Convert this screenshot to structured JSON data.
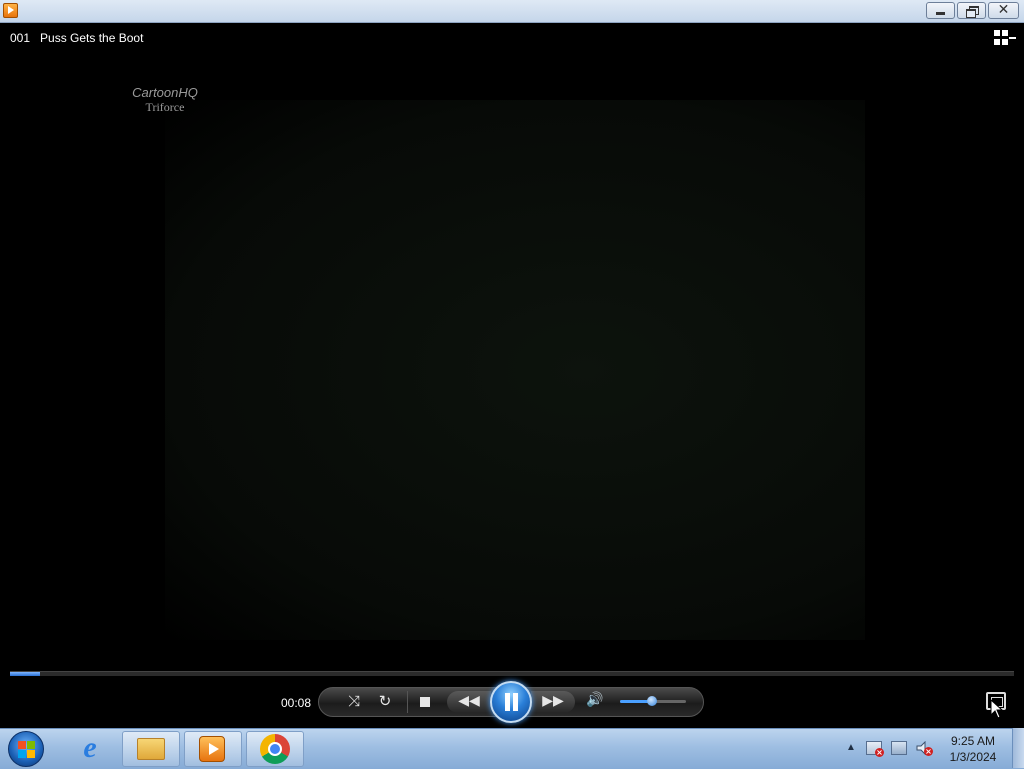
{
  "window": {
    "app_icon": "windows-media-player-icon",
    "controls": {
      "minimize": "minimize-icon",
      "maximize": "restore-icon",
      "close_label": "✕"
    }
  },
  "video": {
    "title": "001   Puss Gets the Boot",
    "watermark_line1": "CartoonHQ",
    "watermark_line2": "Triforce"
  },
  "player": {
    "elapsed": "00:08",
    "progress": 0.03,
    "volume": 0.5,
    "state": "playing",
    "icons": {
      "shuffle": "shuffle-icon",
      "repeat": "repeat-icon",
      "stop": "stop-icon",
      "previous": "previous-icon",
      "play_pause": "pause-icon",
      "next": "next-icon",
      "mute": "speaker-icon",
      "switch_library": "switch-to-library-icon",
      "fullscreen": "fullscreen-icon"
    },
    "glyphs": {
      "shuffle": "⤨",
      "repeat": "↻",
      "previous": "◀◀",
      "next": "▶▶",
      "mute": "🔊"
    },
    "accent": "#2a7fd8"
  },
  "taskbar": {
    "apps": [
      "Internet Explorer",
      "Windows Explorer",
      "Windows Media Player",
      "Google Chrome"
    ],
    "active_app": "Windows Media Player",
    "tray_arrow": "▲",
    "clock_time": "9:25 AM",
    "clock_date": "1/3/2024"
  }
}
